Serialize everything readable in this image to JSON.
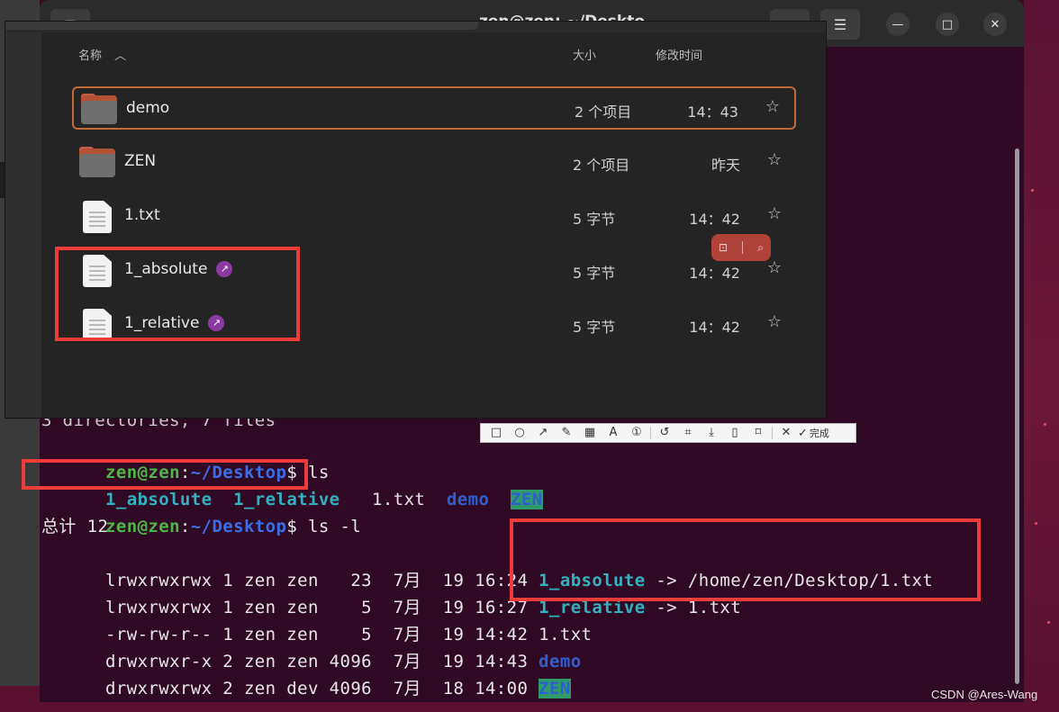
{
  "terminal": {
    "title": "zen@zen: ~/Deskto",
    "partial_top_line": "3 directories, 7 files",
    "prompt_user": "zen@zen",
    "prompt_sep": ":",
    "prompt_path": "~/Desktop",
    "prompt_dollar": "$",
    "cmd_ls": " ls",
    "cmd_ls_l": " ls -l",
    "ls_items": [
      "1_absolute",
      "1_relative",
      "1.txt",
      "demo",
      "ZEN"
    ],
    "total_line": "总计 12",
    "long_rows": [
      {
        "perm": "lrwxrwxrwx 1 zen zen   23  7月  19 16:24 ",
        "name": "1_absolute",
        "rest": " -> /home/zen/Desktop/1.txt"
      },
      {
        "perm": "lrwxrwxrwx 1 zen zen    5  7月  19 16:27 ",
        "name": "1_relative",
        "rest": " -> 1.txt"
      },
      {
        "perm": "-rw-rw-r-- 1 zen zen    5  7月  19 14:42 ",
        "name": "1.txt",
        "rest": ""
      },
      {
        "perm": "drwxrwxr-x 2 zen zen 4096  7月  19 14:43 ",
        "name": "demo",
        "rest": ""
      },
      {
        "perm": "drwxrwxrwx 2 zen dev 4096  7月  18 14:00 ",
        "name": "ZEN",
        "rest": ""
      }
    ]
  },
  "file_manager": {
    "columns": {
      "name": "名称",
      "size": "大小",
      "modified": "修改时间"
    },
    "files": [
      {
        "name": "demo",
        "size": "2 个项目",
        "time": "14：43",
        "type": "folder",
        "selected": true
      },
      {
        "name": "ZEN",
        "size": "2 个项目",
        "time": "昨天",
        "type": "folder"
      },
      {
        "name": "1.txt",
        "size": "5 字节",
        "time": "14：42",
        "type": "file"
      },
      {
        "name": "1_absolute",
        "size": "5 字节",
        "time": "14：42",
        "type": "file",
        "link": true
      },
      {
        "name": "1_relative",
        "size": "5 字节",
        "time": "14：42",
        "type": "file",
        "link": true
      }
    ],
    "star": "☆"
  },
  "annotation_toolbar": {
    "tools": [
      "rect-icon",
      "circle-icon",
      "arrow-icon",
      "pen-icon",
      "mosaic-icon",
      "text-icon",
      "number-icon",
      "undo-icon",
      "ocr-icon",
      "download-icon",
      "pin-icon",
      "bookmark-icon",
      "close-icon",
      "check-icon"
    ],
    "done_label": "完成"
  },
  "watermark": "CSDN @Ares-Wang",
  "colors": {
    "terminal_bg": "#300a24",
    "prompt_green": "#4fb548",
    "path_blue": "#3a6ee8",
    "symlink_cyan": "#34b1c0",
    "highlight_red": "#ee3b3b",
    "selection_orange": "#c16a3a"
  }
}
